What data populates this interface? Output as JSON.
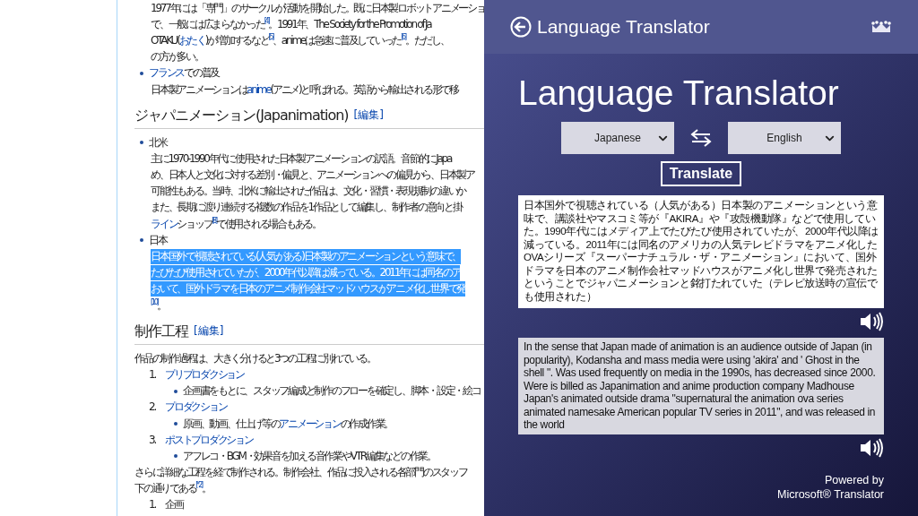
{
  "article": {
    "rows": [
      {
        "kind": "text",
        "selected": false,
        "segments": [
          {
            "text": "1977年には「専門」のサークルが活動を開始した。既に日本製ロボットアニメーショ",
            "link": false
          }
        ]
      },
      {
        "kind": "text",
        "selected": false,
        "segments": [
          {
            "text": "で、一般には広まらなかった$^{[4]}$。1991年、The Society for the Promotion of Ja",
            "link": false
          }
        ]
      },
      {
        "kind": "text",
        "selected": false,
        "segments": [
          {
            "text": "OTAKU(",
            "link": false
          },
          {
            "text": "おたく",
            "link": true
          },
          {
            "text": ")が増加するなど$^{[5]}$、animeは急速に普及していった$^{[6]}$。ただし、",
            "link": false
          }
        ]
      },
      {
        "kind": "text",
        "selected": false,
        "segments": [
          {
            "text": "の方が多い。",
            "link": false
          }
        ]
      },
      {
        "kind": "bullet",
        "selected": false,
        "segments": [
          {
            "text": "フランス",
            "link": true
          },
          {
            "text": "での普及",
            "link": false
          }
        ]
      },
      {
        "kind": "text",
        "selected": false,
        "segments": [
          {
            "text": "日本製アニメーションは",
            "link": false
          },
          {
            "text": "anime",
            "link": true
          },
          {
            "text": "(アニメ)と呼ばれる。英語から輸出される形で移",
            "link": false
          }
        ]
      },
      {
        "kind": "heading",
        "selected": false,
        "segments": [
          {
            "text": "ジャパニメーション(Japanimation)",
            "link": false
          }
        ],
        "edit": "[編集]"
      },
      {
        "kind": "bullet",
        "selected": false,
        "segments": [
          {
            "text": "北米",
            "link": false
          }
        ]
      },
      {
        "kind": "text",
        "selected": false,
        "segments": [
          {
            "text": "主に1970-1990年代に使用された日本製アニメーションの訳語。音節的にJapa",
            "link": false
          }
        ]
      },
      {
        "kind": "text",
        "selected": false,
        "segments": [
          {
            "text": "め、日本人と文化に対する差別・偏見と、アニメーションへの偏見から、日本製ア",
            "link": false
          }
        ]
      },
      {
        "kind": "text",
        "selected": false,
        "segments": [
          {
            "text": "可能性もある。当時、北米に輸出された作品は、文化・習慣・表現規制の違いか",
            "link": false
          }
        ]
      },
      {
        "kind": "text",
        "selected": false,
        "segments": [
          {
            "text": "また、長期に渡り連続する複数の作品を1作品として編集し、制作者の意向と掛",
            "link": false
          }
        ]
      },
      {
        "kind": "text",
        "selected": false,
        "segments": [
          {
            "text": "ライン",
            "link": true
          },
          {
            "text": "ショップ$^{[8]}$で使用される場合もある。",
            "link": false
          }
        ]
      },
      {
        "kind": "bullet",
        "selected": false,
        "segments": [
          {
            "text": "日本",
            "link": false
          }
        ]
      },
      {
        "kind": "text",
        "selected": true,
        "segments": [
          {
            "text": "日本国外で視聴されている(人気がある)日本製のアニメーションという意味で、",
            "link": false
          }
        ]
      },
      {
        "kind": "text",
        "selected": true,
        "segments": [
          {
            "text": "たびたび使用されていたが、2000年代以降は減っている。2011年には同名のア",
            "link": false
          }
        ]
      },
      {
        "kind": "text",
        "selected": true,
        "segments": [
          {
            "text": "おいて、国外ドラマを日本のアニメ制作会社マッドハウスがアニメ化し世界で発",
            "link": false
          }
        ]
      },
      {
        "kind": "text",
        "selected": false,
        "segments": [
          {
            "text": "$^{[10]}$。",
            "link": false
          }
        ]
      },
      {
        "kind": "heading",
        "selected": false,
        "segments": [
          {
            "text": "制作工程",
            "link": false
          }
        ],
        "edit": "[編集]"
      },
      {
        "kind": "body",
        "selected": false,
        "segments": [
          {
            "text": "作品の制作過程は、大きく分けると3つの工程に別れている。",
            "link": false
          }
        ]
      },
      {
        "kind": "number",
        "selected": false,
        "number": "1.",
        "segments": [
          {
            "text": "プリプロダクション",
            "link": true
          }
        ]
      },
      {
        "kind": "subbullet",
        "selected": false,
        "segments": [
          {
            "text": "企画書をもとに、スタッフ編成と制作のフローを確定し、脚本・設定・絵コ",
            "link": false
          }
        ]
      },
      {
        "kind": "number",
        "selected": false,
        "number": "2.",
        "segments": [
          {
            "text": "プロダクション",
            "link": true
          }
        ]
      },
      {
        "kind": "subbullet",
        "selected": false,
        "segments": [
          {
            "text": "原画、動画、仕上げ等の",
            "link": false
          },
          {
            "text": "アニメーション",
            "link": true
          },
          {
            "text": "の作成作業。",
            "link": false
          }
        ]
      },
      {
        "kind": "number",
        "selected": false,
        "number": "3.",
        "segments": [
          {
            "text": "ポストプロダクション",
            "link": true
          }
        ]
      },
      {
        "kind": "subbullet",
        "selected": false,
        "segments": [
          {
            "text": "アフレコ・BGM・効果音を加える音作業やVTR編集などの作業。",
            "link": false
          }
        ]
      },
      {
        "kind": "body",
        "selected": false,
        "segments": [
          {
            "text": "さらに詳細な工程を経て制作される。制作会社、作品に投入される各部門のスタッフ",
            "link": false
          }
        ]
      },
      {
        "kind": "body",
        "selected": false,
        "segments": [
          {
            "text": "下の通りである$^{[* 2]}$。",
            "link": false
          }
        ]
      },
      {
        "kind": "number",
        "selected": false,
        "number": "1.",
        "segments": [
          {
            "text": "企画",
            "link": false
          }
        ]
      }
    ]
  },
  "translator": {
    "app_title": "Language Translator",
    "title": "Language Translator",
    "source_language": "Japanese",
    "target_language": "English",
    "translate_button": "Translate",
    "source_text": "日本国外で視聴されている（人気がある）日本製のアニメーションという意味で、講談社やマスコミ等が『AKIRA』や『攻殻機動隊』などで使用していた。1990年代にはメディア上でたびたび使用されていたが、2000年代以降は減っている。2011年には同名のアメリカの人気テレビドラマをアニメ化したOVAシリーズ『スーパーナチュラル・ザ・アニメーション』において、国外ドラマを日本のアニメ制作会社マッドハウスがアニメ化し世界で発売されたということでジャパニメーションと銘打たれていた（テレビ放送時の宣伝でも使用された）",
    "translated_text": "In the sense that Japan made of animation is an audience outside of Japan (in popularity), Kodansha and mass media were using 'akira' and ' Ghost in the shell \". Was used frequently on media in the 1990s, has decreased since 2000. Were is billed as Japanimation and anime production company Madhouse Japan's animated outside drama \"supernatural the animation ova series animated namesake American popular TV series in 2011\", and was released in the world",
    "powered_by": "Powered by",
    "provider": "Microsoft® Translator"
  }
}
